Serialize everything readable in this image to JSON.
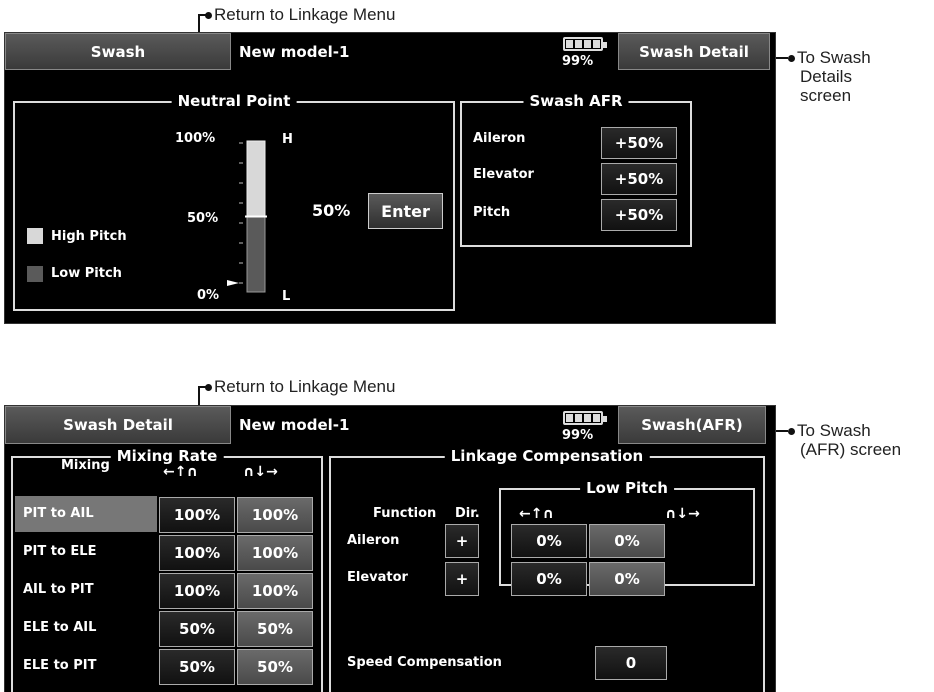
{
  "annotations": {
    "return_top": "Return to Linkage Menu",
    "to_swash_details": [
      "To Swash",
      "Details",
      "screen"
    ],
    "return_bottom": "Return to Linkage Menu",
    "to_swash_afr": [
      "To Swash",
      "(AFR) screen"
    ]
  },
  "screen1": {
    "tab_left": "Swash",
    "model_name": "New model-1",
    "battery_pct": "99%",
    "tab_right": "Swash Detail",
    "neutral_point": {
      "title": "Neutral Point",
      "scale": {
        "top": "100%",
        "mid": "50%",
        "bottom": "0%",
        "high": "H",
        "low": "L"
      },
      "current_value": "50%",
      "enter_label": "Enter",
      "level": 0.5,
      "legend_high": "High Pitch",
      "legend_low": "Low Pitch"
    },
    "swash_afr": {
      "title": "Swash AFR",
      "rows": [
        {
          "label": "Aileron",
          "value": "+50%"
        },
        {
          "label": "Elevator",
          "value": "+50%"
        },
        {
          "label": "Pitch",
          "value": "+50%"
        }
      ]
    }
  },
  "screen2": {
    "tab_left": "Swash Detail",
    "model_name": "New model-1",
    "battery_pct": "99%",
    "tab_right": "Swash(AFR)",
    "mixing_rate": {
      "title": "Mixing Rate",
      "col_mixing": "Mixing",
      "col_a": "←↑∩",
      "col_b": "∩↓→",
      "rows": [
        {
          "label": "PIT to AIL",
          "a": "100%",
          "b": "100%"
        },
        {
          "label": "PIT to ELE",
          "a": "100%",
          "b": "100%"
        },
        {
          "label": "AIL to PIT",
          "a": "100%",
          "b": "100%"
        },
        {
          "label": "ELE to AIL",
          "a": "50%",
          "b": "50%"
        },
        {
          "label": "ELE to PIT",
          "a": "50%",
          "b": "50%"
        }
      ]
    },
    "linkage_comp": {
      "title": "Linkage Compensation",
      "col_function": "Function",
      "col_dir": "Dir.",
      "low_pitch_title": "Low Pitch",
      "col_a": "←↑∩",
      "col_b": "∩↓→",
      "rows": [
        {
          "label": "Aileron",
          "dir": "+",
          "a": "0%",
          "b": "0%"
        },
        {
          "label": "Elevator",
          "dir": "+",
          "a": "0%",
          "b": "0%"
        }
      ],
      "speed_label": "Speed Compensation",
      "speed_value": "0"
    }
  }
}
